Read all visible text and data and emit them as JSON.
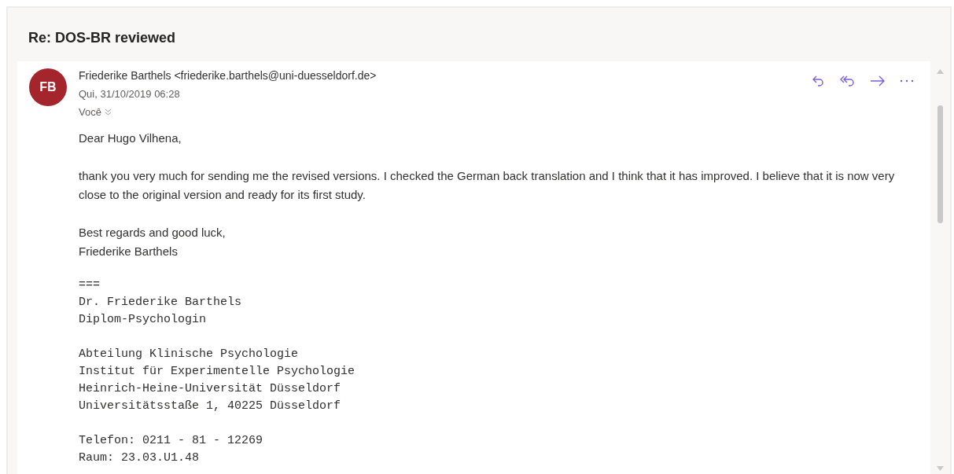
{
  "subject": "Re: DOS-BR reviewed",
  "message": {
    "avatar_initials": "FB",
    "sender": "Friederike Barthels <friederike.barthels@uni-duesseldorf.de>",
    "date": "Qui, 31/10/2019 06:28",
    "recipient": "Você",
    "actions": [
      {
        "kind": "reply"
      },
      {
        "kind": "reply-all"
      },
      {
        "kind": "forward"
      },
      {
        "kind": "more"
      }
    ],
    "greeting": "Dear Hugo Vilhena,",
    "paragraphs": [
      "thank you very much for sending me the revised versions. I checked the German back translation and I think that it has  improved. I believe that it is now very close to the original version and ready for its first study."
    ],
    "closing": [
      "Best regards and good luck,",
      "Friederike Barthels"
    ],
    "signature": [
      [
        "===",
        "Dr. Friederike Barthels",
        "Diplom-Psychologin"
      ],
      [
        "Abteilung Klinische Psychologie",
        "Institut für Experimentelle Psychologie",
        "Heinrich-Heine-Universität Düsseldorf",
        "Universitätsstaße 1, 40225 Düsseldorf"
      ],
      [
        "Telefon: 0211 - 81 - 12269",
        "Raum: 23.03.U1.48"
      ]
    ]
  }
}
